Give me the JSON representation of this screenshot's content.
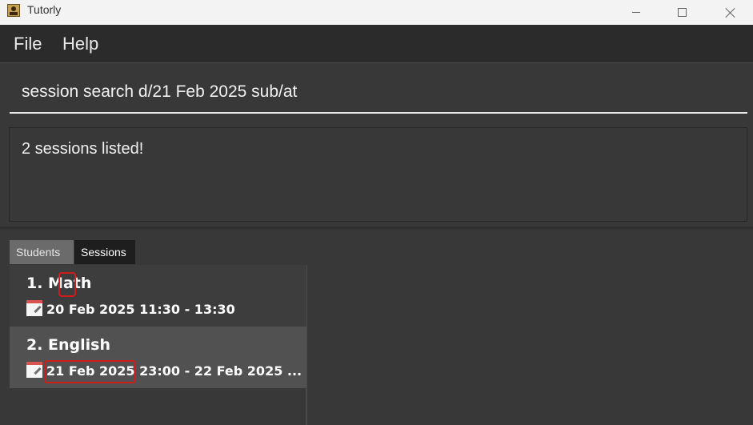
{
  "window": {
    "title": "Tutorly",
    "icon": "app-icon",
    "controls": [
      "minimize-icon",
      "maximize-icon",
      "close-icon"
    ]
  },
  "menu": {
    "file": "File",
    "help": "Help"
  },
  "command": {
    "value": "session search d/21 Feb 2025 sub/at"
  },
  "result": {
    "text": "2 sessions listed!"
  },
  "tabs": [
    {
      "label": "Students",
      "selected": false
    },
    {
      "label": "Sessions",
      "selected": true
    }
  ],
  "sessions": [
    {
      "title": "1. Math",
      "datetime": "20 Feb 2025 11:30 - 13:30",
      "icon": "calendar-icon"
    },
    {
      "title": "2. English",
      "datetime": "21 Feb 2025 23:00 - 22 Feb 2025 ...",
      "icon": "calendar-icon"
    }
  ],
  "colors": {
    "background": "#383838",
    "menubar": "#2b2b2b",
    "tab_selected": "#1e1e1e",
    "tab_unselected": "#6b6b6b",
    "list_item_selected": "#515151",
    "highlight": "#d11c1c"
  }
}
